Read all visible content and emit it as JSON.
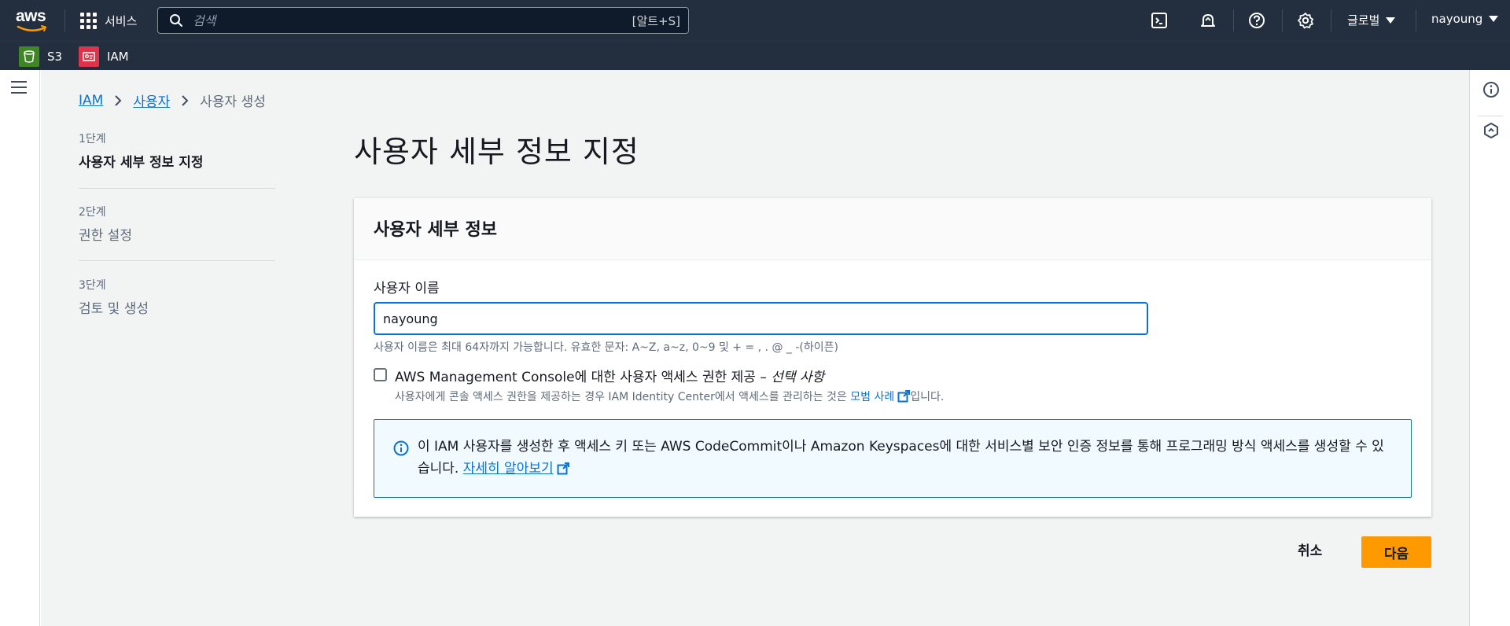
{
  "topnav": {
    "logo_text": "aws",
    "services_label": "서비스",
    "search_placeholder": "검색",
    "search_shortcut": "[알트+S]",
    "region_label": "글로벌",
    "user_label": "nayoung",
    "icons": [
      "cloudshell-icon",
      "notifications-icon",
      "help-icon",
      "settings-icon"
    ]
  },
  "favorites": [
    {
      "label": "S3",
      "icon": "s3-icon",
      "color": "#3f8624"
    },
    {
      "label": "IAM",
      "icon": "iam-icon",
      "color": "#dd344c"
    }
  ],
  "breadcrumb": {
    "items": [
      "IAM",
      "사용자"
    ],
    "current": "사용자 생성"
  },
  "steps": [
    {
      "label": "1단계",
      "name": "사용자 세부 정보 지정",
      "active": true
    },
    {
      "label": "2단계",
      "name": "권한 설정",
      "active": false
    },
    {
      "label": "3단계",
      "name": "검토 및 생성",
      "active": false
    }
  ],
  "page": {
    "title": "사용자 세부 정보 지정"
  },
  "panel": {
    "title": "사용자 세부 정보",
    "field_label": "사용자 이름",
    "username_value": "nayoung",
    "field_hint": "사용자 이름은 최대 64자까지 가능합니다. 유효한 문자: A~Z, a~z, 0~9 및 + = , . @ _ -(하이픈)",
    "console_checkbox_label": "AWS Management Console에 대한 사용자 액세스 권한 제공 –",
    "console_checkbox_optional": "선택 사항",
    "console_desc_prefix": "사용자에게 콘솔 액세스 권한을 제공하는 경우 IAM Identity Center에서 액세스를 관리하는 것은 ",
    "console_desc_link": "모범 사례",
    "console_desc_suffix": "입니다.",
    "console_checked": false,
    "info_text": "이 IAM 사용자를 생성한 후 액세스 키 또는 AWS CodeCommit이나 Amazon Keyspaces에 대한 서비스별 보안 인증 정보를 통해 프로그래밍 방식 액세스를 생성할 수 있습니다.",
    "info_link": "자세히 알아보기"
  },
  "actions": {
    "cancel_label": "취소",
    "next_label": "다음"
  },
  "colors": {
    "nav_bg": "#232f3e",
    "link": "#0972d3",
    "primary_button": "#ff9900",
    "page_bg": "#f2f3f3"
  }
}
